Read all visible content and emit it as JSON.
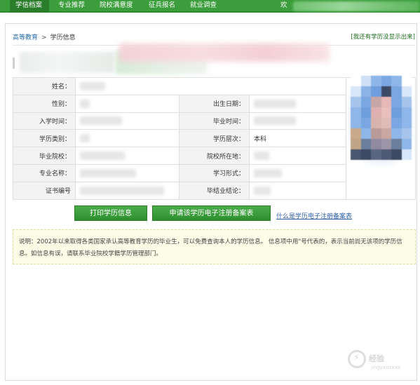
{
  "nav": {
    "items": [
      "学信档案",
      "专业推荐",
      "院校满意度",
      "征兵报名",
      "就业调查"
    ],
    "welcome": "欢"
  },
  "breadcrumb": {
    "home": "高等教育",
    "separator": ">",
    "current": "学历信息"
  },
  "missing_link": "[我还有学历没显示出来]",
  "record": {
    "name_label": "姓名：",
    "gender_label": "性别：",
    "birth_label": "出生日期：",
    "enroll_label": "入学时间：",
    "grad_time_label": "毕业时间：",
    "category_label": "学历类别：",
    "level_label": "学历层次：",
    "level_value": "本科",
    "school_label": "毕业院校：",
    "location_label": "院校所在地：",
    "major_label": "专业名称：",
    "form_label": "学习形式：",
    "cert_label": "证书编号",
    "conclusion_label": "毕结业结论："
  },
  "buttons": {
    "print": "打印学历信息",
    "apply": "申请该学历电子注册备案表",
    "help": "什么是学历电子注册备案表"
  },
  "note": "说明：2002年以来取得各类国家承认高等教育学历的毕业生，可以免费查询本人的学历信息。   信息项中用\"号代表的，表示当前尚无该项的学历信息。如信息有误，请联系毕业院校学籍学历管理部门。",
  "watermark": {
    "name": "经验",
    "sub": "jingyanxxxx"
  },
  "colors": {
    "nav_green": "#3b9d3b",
    "button_green": "#3a9b3a",
    "link_blue": "#2d5fa8",
    "note_bg": "#fcfce7"
  }
}
